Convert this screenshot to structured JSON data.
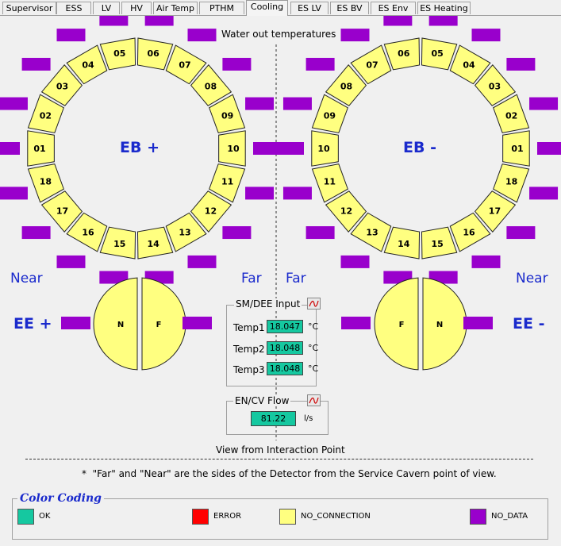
{
  "tabs": [
    "Supervisor",
    "ESS",
    "LV",
    "HV",
    "Air Temp",
    "PTHM",
    "Cooling",
    "ES LV",
    "ES BV",
    "ES Env",
    "ES Heating"
  ],
  "active_tab": "Cooling",
  "title": "Water out temperatures",
  "eb_plus": {
    "label": "EB +",
    "sectors": [
      "01",
      "02",
      "03",
      "04",
      "05",
      "06",
      "07",
      "08",
      "09",
      "10",
      "11",
      "12",
      "13",
      "14",
      "15",
      "16",
      "17",
      "18"
    ]
  },
  "eb_minus": {
    "label": "EB -",
    "sectors": [
      "01",
      "02",
      "03",
      "04",
      "05",
      "06",
      "07",
      "08",
      "09",
      "10",
      "11",
      "12",
      "13",
      "14",
      "15",
      "16",
      "17",
      "18"
    ]
  },
  "near_left": "Near",
  "far_left": "Far",
  "far_right": "Far",
  "near_right": "Near",
  "ee_plus": {
    "label": "EE +",
    "left": "N",
    "right": "F"
  },
  "ee_minus": {
    "label": "EE -",
    "left": "F",
    "right": "N"
  },
  "smdee": {
    "title": "SM/DEE Input",
    "rows": [
      {
        "label": "Temp1",
        "value": "18.047",
        "unit": "°C"
      },
      {
        "label": "Temp2",
        "value": "18.048",
        "unit": "°C"
      },
      {
        "label": "Temp3",
        "value": "18.048",
        "unit": "°C"
      }
    ]
  },
  "flow": {
    "title": "EN/CV Flow",
    "value": "81.22",
    "unit": "l/s"
  },
  "view_label": "View from Interaction Point",
  "footnote": "*  \"Far\" and \"Near\" are the sides of the Detector from the Service Cavern point of view.",
  "legend": {
    "title": "Color Coding",
    "items": [
      {
        "label": "OK",
        "color": "#15c8a0"
      },
      {
        "label": "ERROR",
        "color": "#ff0000"
      },
      {
        "label": "NO_CONNECTION",
        "color": "#ffff80"
      },
      {
        "label": "NO_DATA",
        "color": "#9900cc"
      }
    ]
  },
  "colors": {
    "no_data": "#9900cc",
    "no_connection": "#ffff80",
    "ok": "#15c8a0",
    "text_blue": "#1a2acc"
  }
}
